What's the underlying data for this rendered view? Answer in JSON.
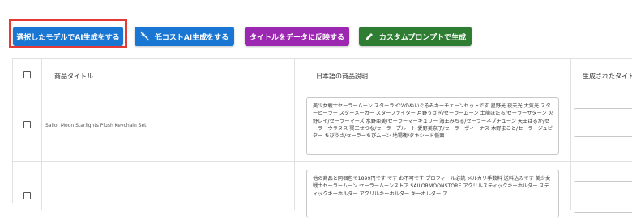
{
  "toolbar": {
    "generate_selected_label": "選択したモデルでAI生成をする",
    "low_cost_label": "低コストAI生成をする",
    "reflect_title_label": "タイトルをデータに反映する",
    "custom_prompt_label": "カスタムプロンプトで生成"
  },
  "table": {
    "columns": [
      "商品タイトル",
      "日本語の商品説明",
      "生成されたタイト"
    ],
    "rows": [
      {
        "title": "Sailor Moon Starlights Plush Keychain Set",
        "description": "美少女戦士セーラームーン スターライツのぬいぐるみキーチェーンセットです 星野光 夜天光 大気光 スターヒーラー スターメーカー スターファイター 月野うさぎ/セーラームーン 土萠ほたる/セーラーサターン 火野レイ/セーラーマーズ 水野亜美/セーラーマーキュリー 海王みちる/セーラーネプチューン 天王はるか/セーラーウラヌス 冥王せつな/セーラープルート 愛野美奈子/セーラーヴィーナス 木野まこと/セーラージュピター ちびうさ/セーラーちびムーン 地場衛/タキシード仮面"
      },
      {
        "title": "",
        "description": "他の商品と同梱包で1899円です です お不可です プロフィール必読 メルカリ手数料 送料込みです 美少女戦士セーラームーン セーラームーンストア SAILORMOONSTORE アクリルスティックキーホルダー スティックキーホルダー アクリルキーホルダー キーホルダー ア"
      }
    ]
  },
  "colors": {
    "primary": "#1976d2",
    "purple": "#9c27b0",
    "green": "#2e7d32",
    "highlight": "#e53935"
  },
  "icons": [
    "sparkle-off-icon",
    "pencil-icon",
    "checkbox-icon"
  ]
}
